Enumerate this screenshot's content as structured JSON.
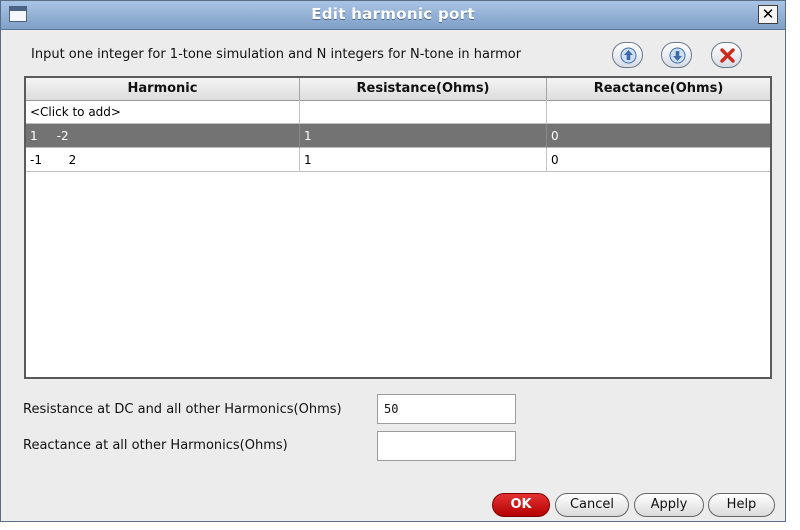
{
  "window": {
    "title": "Edit harmonic port"
  },
  "instruction": "Input one integer for 1-tone simulation and N integers for N-tone in harmor",
  "toolbar": {
    "move_up_icon": "arrow-up-icon",
    "move_down_icon": "arrow-down-icon",
    "delete_icon": "x-delete-icon"
  },
  "table": {
    "columns": [
      "Harmonic",
      "Resistance(Ohms)",
      "Reactance(Ohms)"
    ],
    "add_row": "<Click to add>",
    "rows": [
      {
        "harmonic": "1     -2",
        "resistance": "1",
        "reactance": "0",
        "selected": true
      },
      {
        "harmonic": "-1       2",
        "resistance": "1",
        "reactance": "0",
        "selected": false
      }
    ]
  },
  "fields": {
    "resistance_label": "Resistance at DC and all other Harmonics(Ohms)",
    "resistance_value": "50",
    "reactance_label": "Reactance at all other Harmonics(Ohms)",
    "reactance_value": ""
  },
  "buttons": {
    "ok": "OK",
    "cancel": "Cancel",
    "apply": "Apply",
    "help": "Help"
  },
  "colors": {
    "title_bar": "#8fadd4",
    "selected_row": "#737373",
    "ok_button": "#cc1111"
  }
}
